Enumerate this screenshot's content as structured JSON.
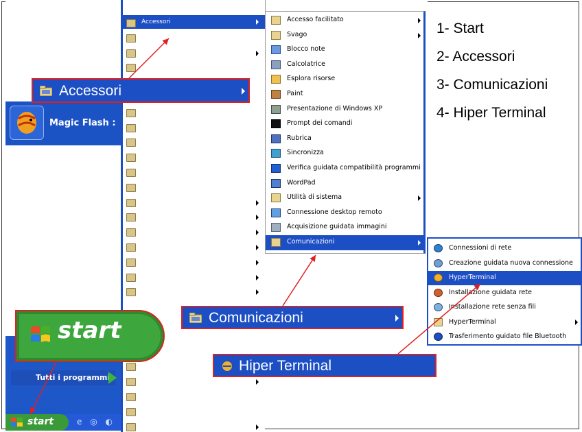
{
  "legend": {
    "items": [
      "1- Start",
      "2- Accessori",
      "3- Comunicazioni",
      "4- Hiper Terminal"
    ]
  },
  "start_menu": {
    "pinned_label": "Magic Flash :",
    "all_programs_label": "Tutti i programmi",
    "start_label": "start",
    "selected_program": "Accessori"
  },
  "accessori_menu": {
    "items": [
      {
        "label": "Accesso facilitato",
        "icon": "folder-icon",
        "submenu": true
      },
      {
        "label": "Svago",
        "icon": "folder-icon",
        "submenu": true
      },
      {
        "label": "Blocco note",
        "icon": "notepad-icon",
        "submenu": false
      },
      {
        "label": "Calcolatrice",
        "icon": "calculator-icon",
        "submenu": false
      },
      {
        "label": "Esplora risorse",
        "icon": "explorer-icon",
        "submenu": false
      },
      {
        "label": "Paint",
        "icon": "paint-icon",
        "submenu": false
      },
      {
        "label": "Presentazione di Windows XP",
        "icon": "tour-icon",
        "submenu": false
      },
      {
        "label": "Prompt dei comandi",
        "icon": "cmd-icon",
        "submenu": false
      },
      {
        "label": "Rubrica",
        "icon": "address-book-icon",
        "submenu": false
      },
      {
        "label": "Sincronizza",
        "icon": "sync-icon",
        "submenu": false
      },
      {
        "label": "Verifica guidata compatibilità programmi",
        "icon": "help-icon",
        "submenu": false
      },
      {
        "label": "WordPad",
        "icon": "wordpad-icon",
        "submenu": false
      },
      {
        "label": "Utilità di sistema",
        "icon": "folder-icon",
        "submenu": true
      },
      {
        "label": "Connessione desktop remoto",
        "icon": "remote-desktop-icon",
        "submenu": false
      },
      {
        "label": "Acquisizione guidata immagini",
        "icon": "scanner-icon",
        "submenu": false
      },
      {
        "label": "Comunicazioni",
        "icon": "folder-icon",
        "submenu": true,
        "selected": true
      }
    ]
  },
  "comunicazioni_menu": {
    "items": [
      {
        "label": "Connessioni di rete",
        "icon": "network-icon",
        "submenu": false
      },
      {
        "label": "Creazione guidata nuova connessione",
        "icon": "wizard-icon",
        "submenu": false
      },
      {
        "label": "HyperTerminal",
        "icon": "hyperterminal-icon",
        "submenu": false,
        "selected": true
      },
      {
        "label": "Installazione guidata rete",
        "icon": "network-setup-icon",
        "submenu": false
      },
      {
        "label": "Installazione rete senza fili",
        "icon": "wireless-icon",
        "submenu": false
      },
      {
        "label": "HyperTerminal",
        "icon": "folder-icon",
        "submenu": true
      },
      {
        "label": "Trasferimento guidato file Bluetooth",
        "icon": "bluetooth-icon",
        "submenu": false
      }
    ]
  },
  "callouts": {
    "accessori": "Accessori",
    "comunicazioni": "Comunicazioni",
    "hiper_terminal": "Hiper Terminal",
    "start": "start"
  },
  "colors": {
    "menu_blue": "#1c4ec4",
    "callout_border": "#e02020",
    "start_green": "#3da63d"
  }
}
